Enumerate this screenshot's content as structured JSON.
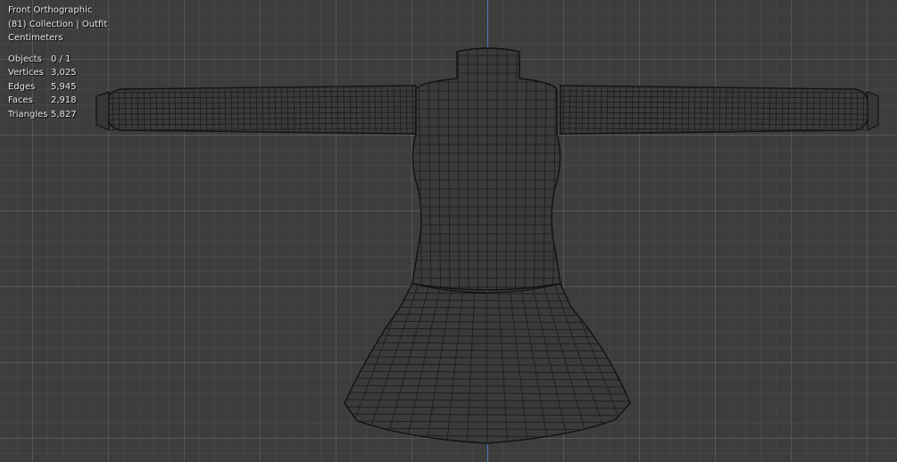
{
  "viewport": {
    "view_name": "Front Orthographic",
    "collection_label": "(81) Collection | Outfit",
    "units": "Centimeters",
    "stats": [
      {
        "label": "Objects",
        "value": "0 / 1"
      },
      {
        "label": "Vertices",
        "value": "3,025"
      },
      {
        "label": "Edges",
        "value": "5,945"
      },
      {
        "label": "Faces",
        "value": "2,918"
      },
      {
        "label": "Triangles",
        "value": "5,827"
      }
    ]
  },
  "colors": {
    "background": "#3d3d3d",
    "z_axis": "#4a7bc0",
    "wire": "#111111",
    "mesh_fill": "#3a3a3a"
  }
}
